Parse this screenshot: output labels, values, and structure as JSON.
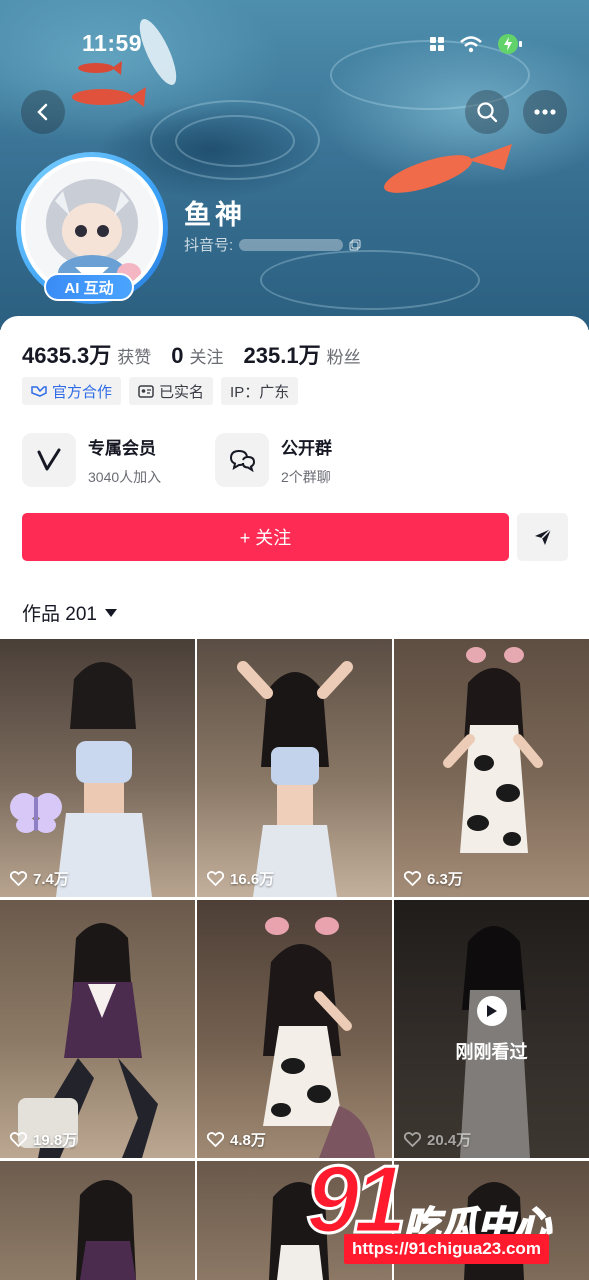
{
  "status_bar": {
    "time": "11:59"
  },
  "profile": {
    "name": "鱼神",
    "douyin_id_label": "抖音号:",
    "ai_badge": "AI 互动"
  },
  "stats": [
    {
      "value": "4635.3万",
      "label": "获赞"
    },
    {
      "value": "0",
      "label": "关注"
    },
    {
      "value": "235.1万",
      "label": "粉丝"
    }
  ],
  "tags": [
    {
      "label": "官方合作",
      "icon": "handshake-icon"
    },
    {
      "label": "已实名",
      "icon": "id-card-icon"
    },
    {
      "label": "IP：广东",
      "icon": ""
    }
  ],
  "features": [
    {
      "title": "专属会员",
      "subtitle": "3040人加入",
      "icon": "v-membership-icon"
    },
    {
      "title": "公开群",
      "subtitle": "2个群聊",
      "icon": "chat-bubbles-icon"
    }
  ],
  "actions": {
    "follow_label": "+ 关注"
  },
  "works": {
    "label": "作品 201"
  },
  "videos": [
    {
      "likes": "7.4万",
      "watched": false
    },
    {
      "likes": "16.6万",
      "watched": false
    },
    {
      "likes": "6.3万",
      "watched": false
    },
    {
      "likes": "19.8万",
      "watched": false
    },
    {
      "likes": "4.8万",
      "watched": false
    },
    {
      "likes": "20.4万",
      "watched": true,
      "watched_label": "刚刚看过"
    },
    {
      "likes": "",
      "watched": false
    },
    {
      "likes": "",
      "watched": false
    },
    {
      "likes": "",
      "watched": false
    }
  ],
  "watermark": {
    "logo_number": "91",
    "logo_text": "吃瓜中心",
    "url": "https://91chigua23.com"
  },
  "colors": {
    "follow": "#fe2c55",
    "official_tag": "#2f6ce5",
    "avatar_ring": "#3aa0f5"
  }
}
